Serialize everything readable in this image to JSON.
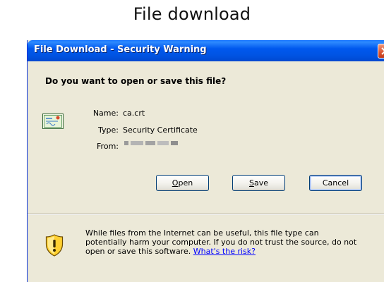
{
  "page": {
    "heading": "File download"
  },
  "dialog": {
    "title": "File Download - Security Warning",
    "question": "Do you want to open or save this file?",
    "icon": "certificate-file-icon",
    "fields": {
      "name_label": "Name:",
      "name_value": "ca.crt",
      "type_label": "Type:",
      "type_value": "Security Certificate",
      "from_label": "From:"
    },
    "buttons": {
      "open_mnemonic": "O",
      "open_rest": "pen",
      "save_mnemonic": "S",
      "save_rest": "ave",
      "cancel": "Cancel"
    },
    "warning": {
      "icon": "shield-warning-icon",
      "line1": "While files from the Internet can be useful, this file type can",
      "line2": "potentially harm your computer. If you do not trust the source, do not",
      "line3": "open or save this software.",
      "link": "What's the risk?"
    }
  },
  "colors": {
    "titlebar": "#0054e3",
    "dialog_background": "#ece9d8",
    "link": "#0000ff",
    "close_button": "#d9532f"
  }
}
